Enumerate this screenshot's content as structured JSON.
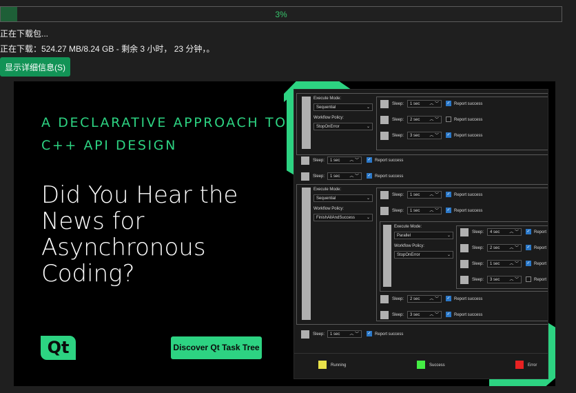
{
  "download": {
    "percent_label": "3%",
    "progress_fraction": 0.03,
    "status": "正在下载包...",
    "detail": "正在下载：524.27 MB/8.24 GB - 剩余 3 小时， 23 分钟，。",
    "details_button": "显示详细信息(S)"
  },
  "ad": {
    "tagline_1": "A DECLARATIVE APPROACH TO",
    "tagline_2": "C++ API DESIGN",
    "headline": "Did You Hear the News for Asynchronous Coding?",
    "logo_text": "Qt",
    "cta_label": "Discover Qt Task Tree",
    "accent_color": "#2dd382"
  },
  "screenshot": {
    "execute_mode_label": "Execute Mode:",
    "workflow_policy_label": "Workflow Policy:",
    "sleep_label": "Sleep:",
    "report_label": "Report success",
    "report_short": "Report",
    "g1": {
      "mode": "Sequential",
      "policy": "StopOnError",
      "rows": [
        {
          "sleep": "1 sec",
          "checked": true
        },
        {
          "sleep": "2 sec",
          "checked": false
        },
        {
          "sleep": "3 sec",
          "checked": true
        }
      ]
    },
    "mid": [
      {
        "sleep": "1 sec",
        "checked": true
      },
      {
        "sleep": "1 sec",
        "checked": true
      }
    ],
    "g2": {
      "mode": "Sequential",
      "policy": "FinishAllAndSuccess",
      "rows": [
        {
          "sleep": "1 sec",
          "checked": true
        },
        {
          "sleep": "1 sec",
          "checked": true
        }
      ],
      "tail": [
        {
          "sleep": "2 sec",
          "checked": true
        },
        {
          "sleep": "3 sec",
          "checked": true
        }
      ]
    },
    "g3": {
      "mode": "Parallel",
      "policy": "StopOnError",
      "rows": [
        {
          "sleep": "4 sec",
          "checked": true
        },
        {
          "sleep": "2 sec",
          "checked": true
        },
        {
          "sleep": "1 sec",
          "checked": true
        },
        {
          "sleep": "3 sec",
          "checked": false
        }
      ]
    },
    "last": {
      "sleep": "1 sec",
      "checked": true
    },
    "legend": [
      {
        "label": "Running",
        "color": "#e9e24a"
      },
      {
        "label": "Success",
        "color": "#44ee44"
      },
      {
        "label": "Error",
        "color": "#e82222"
      }
    ]
  }
}
